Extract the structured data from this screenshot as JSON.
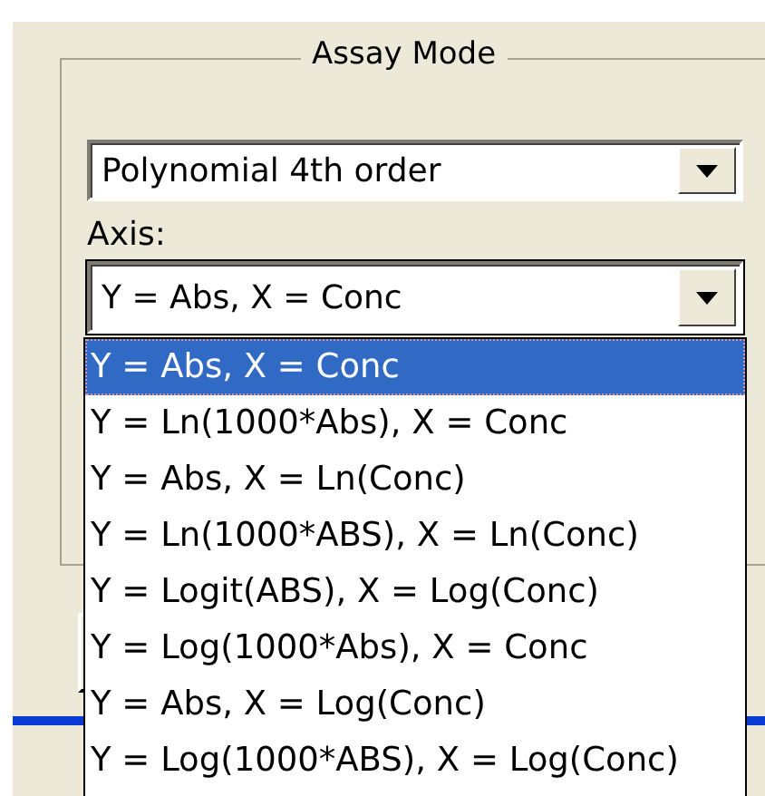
{
  "group_box": {
    "title": "Assay Mode"
  },
  "mode_combo": {
    "value": "Polynomial 4th order"
  },
  "axis_label": "Axis:",
  "axis_combo": {
    "value": "Y = Abs, X = Conc",
    "expanded": true,
    "options": [
      {
        "label": "Y = Abs, X = Conc",
        "selected": true
      },
      {
        "label": "Y = Ln(1000*Abs), X = Conc",
        "selected": false
      },
      {
        "label": "Y = Abs, X = Ln(Conc)",
        "selected": false
      },
      {
        "label": "Y = Ln(1000*ABS), X = Ln(Conc)",
        "selected": false
      },
      {
        "label": "Y = Logit(ABS), X = Log(Conc)",
        "selected": false
      },
      {
        "label": "Y = Log(1000*Abs), X = Conc",
        "selected": false
      },
      {
        "label": "Y = Abs, X = Log(Conc)",
        "selected": false
      },
      {
        "label": "Y = Log(1000*ABS), X = Log(Conc)",
        "selected": false
      }
    ]
  }
}
